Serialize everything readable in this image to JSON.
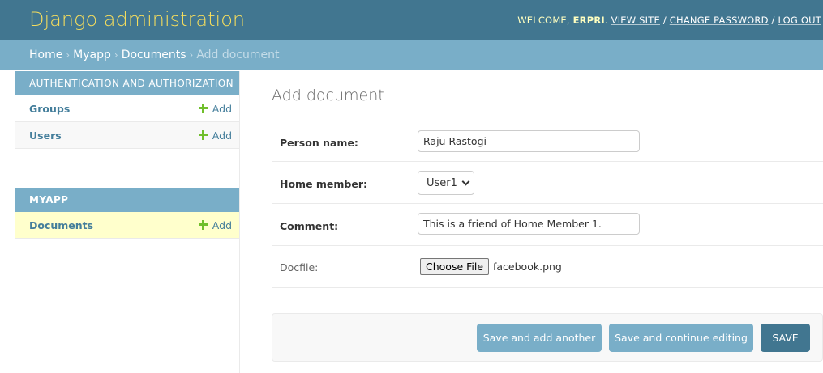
{
  "header": {
    "brand": "Django administration",
    "welcome_prefix": "WELCOME, ",
    "username": "ERPRI",
    "welcome_suffix": ". ",
    "view_site": "VIEW SITE",
    "change_password": "CHANGE PASSWORD",
    "log_out": "LOG OUT",
    "separator": " / "
  },
  "breadcrumbs": {
    "home": "Home",
    "app": "Myapp",
    "model": "Documents",
    "current": "Add document",
    "separator": "›"
  },
  "sidebar": {
    "modules": [
      {
        "caption": "AUTHENTICATION AND AUTHORIZATION",
        "models": [
          {
            "name": "Groups",
            "add": "Add"
          },
          {
            "name": "Users",
            "add": "Add"
          }
        ]
      },
      {
        "caption": "MYAPP",
        "models": [
          {
            "name": "Documents",
            "add": "Add"
          }
        ]
      }
    ]
  },
  "main": {
    "title": "Add document",
    "fields": {
      "person_name": {
        "label": "Person name:",
        "value": "Raju Rastogi"
      },
      "home_member": {
        "label": "Home member:",
        "value": "User1"
      },
      "comment": {
        "label": "Comment:",
        "value": "This is a friend of Home Member 1."
      },
      "docfile": {
        "label": "Docfile:",
        "button": "Choose File",
        "file_name": "facebook.png"
      }
    }
  },
  "submit": {
    "save_add_another": "Save and add another",
    "save_continue": "Save and continue editing",
    "save": "SAVE"
  },
  "colors": {
    "header_bg": "#417690",
    "brand": "#f5dd5d",
    "breadcrumb_bg": "#79aec8",
    "link": "#447e9b",
    "add_plus": "#70bf2b",
    "selected_row": "#ffffcc",
    "primary_button": "#417690",
    "secondary_button": "#79aec8"
  },
  "icons": {
    "add": "plus-icon",
    "select": "chevron-down-icon"
  }
}
